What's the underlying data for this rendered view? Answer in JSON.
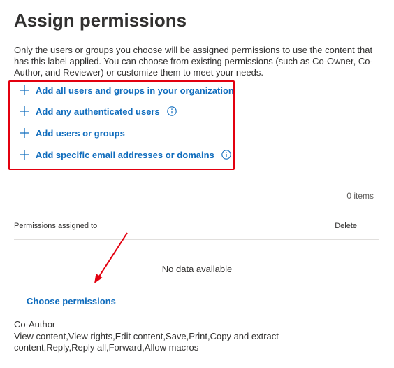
{
  "page": {
    "title": "Assign permissions",
    "description": "Only the users or groups you choose will be assigned permissions to use the content that has this label applied. You can choose from existing permissions (such as Co-Owner, Co-Author, and Reviewer) or customize them to meet your needs."
  },
  "actions": [
    {
      "label": "Add all users and groups in your organization",
      "icon": "plus-icon",
      "info": false
    },
    {
      "label": "Add any authenticated users",
      "icon": "plus-icon",
      "info": true
    },
    {
      "label": "Add users or groups",
      "icon": "plus-icon",
      "info": false
    },
    {
      "label": "Add specific email addresses or domains",
      "icon": "plus-icon",
      "info": true
    }
  ],
  "table": {
    "item_count": "0 items",
    "col_permissions": "Permissions assigned to",
    "col_delete": "Delete",
    "empty_text": "No data available"
  },
  "choose_permissions": "Choose permissions",
  "permission_level": {
    "name": "Co-Author",
    "rights": "View content,View rights,Edit content,Save,Print,Copy and extract content,Reply,Reply all,Forward,Allow macros"
  },
  "colors": {
    "link": "#0f6cbd",
    "highlight": "#e3000f",
    "text": "#323130"
  }
}
